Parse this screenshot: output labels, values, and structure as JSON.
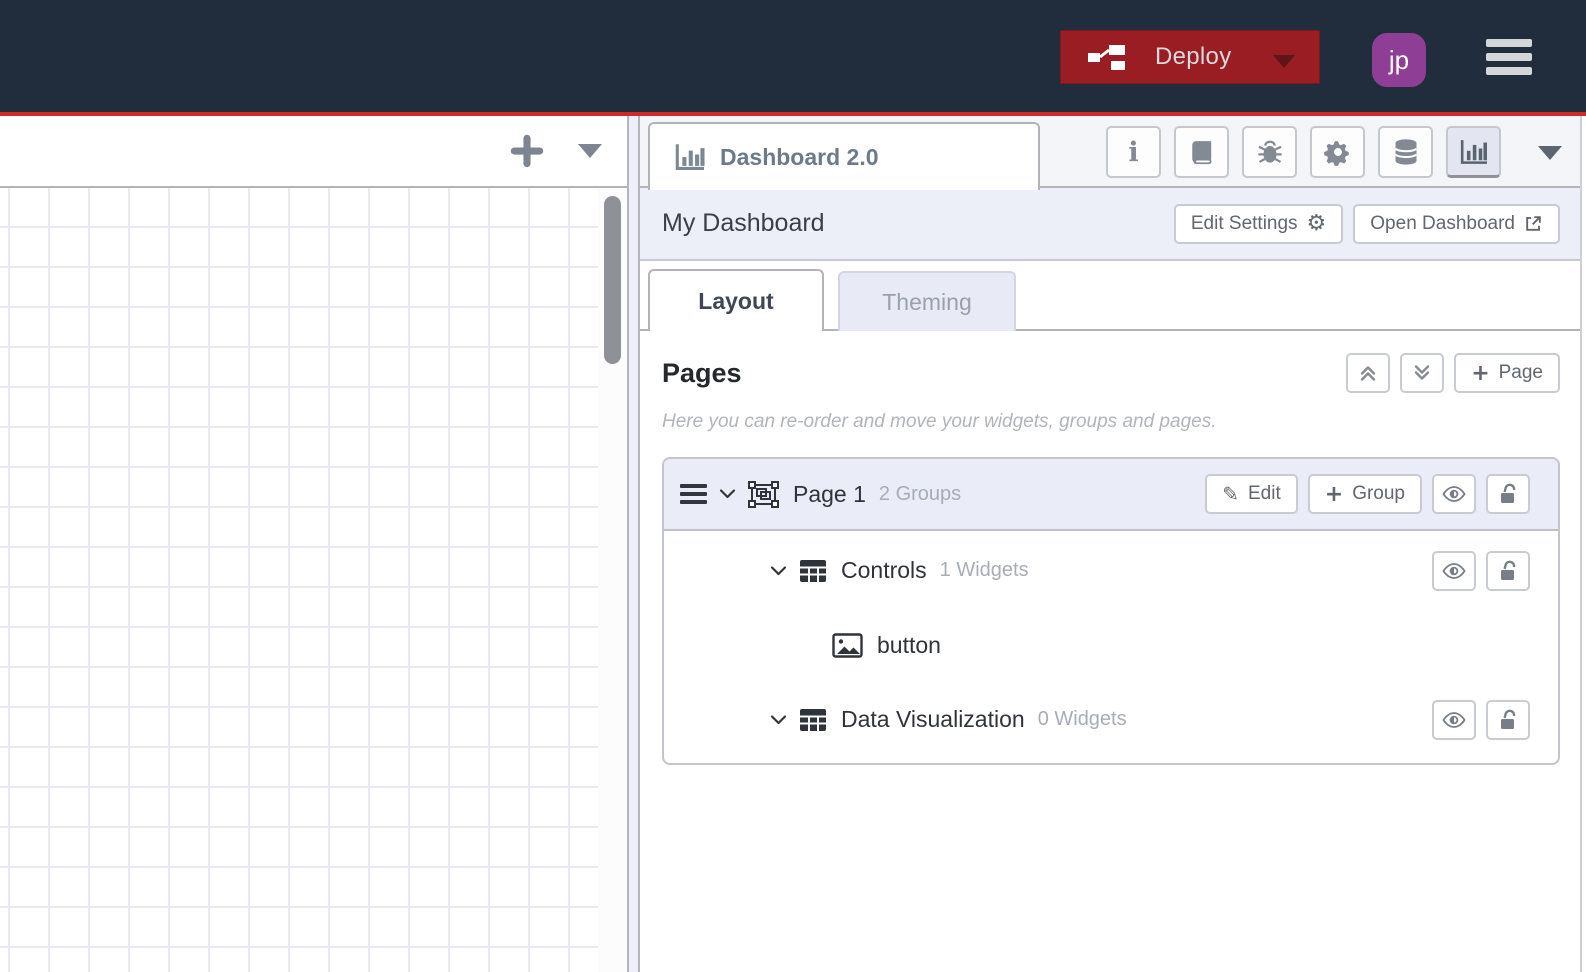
{
  "header": {
    "deploy": {
      "label": "Deploy"
    },
    "avatar": {
      "initials": "jp"
    }
  },
  "workspace": {
    "toolbar_icons": [
      "add-flow-icon",
      "flow-list-caret-icon"
    ]
  },
  "sidebar": {
    "active_tab": {
      "title": "Dashboard 2.0",
      "icon": "bar-chart-icon"
    },
    "toolbar_icons": [
      "info-icon",
      "help-book-icon",
      "debug-bug-icon",
      "config-gear-icon",
      "context-database-icon",
      "dashboard-chart-icon"
    ],
    "panel": {
      "title": "My Dashboard",
      "edit_settings_label": "Edit Settings",
      "open_dashboard_label": "Open Dashboard"
    },
    "tabs": [
      {
        "label": "Layout",
        "active": true
      },
      {
        "label": "Theming",
        "active": false
      }
    ],
    "pages": {
      "title": "Pages",
      "add_page_label": "Page",
      "description": "Here you can re-order and move your widgets, groups and pages.",
      "page": {
        "title": "Page 1",
        "meta": "2 Groups",
        "edit_label": "Edit",
        "add_group_label": "Group",
        "groups": [
          {
            "name": "Controls",
            "meta": "1 Widgets",
            "widgets": [
              {
                "name": "button"
              }
            ]
          },
          {
            "name": "Data Visualization",
            "meta": "0 Widgets",
            "widgets": []
          }
        ]
      }
    }
  },
  "icons": {
    "info_glyph": "i",
    "gear_glyph": "⚙",
    "pencil_glyph": "✎",
    "plus_glyph": "+"
  },
  "colors": {
    "header_dark": "#212c3c",
    "accent_red": "#d02a2a",
    "deploy_red": "#9a1d23",
    "avatar_purple": "#8f3e96",
    "row_lavender": "#eaecf7",
    "grid_line": "#e9e9f4"
  }
}
